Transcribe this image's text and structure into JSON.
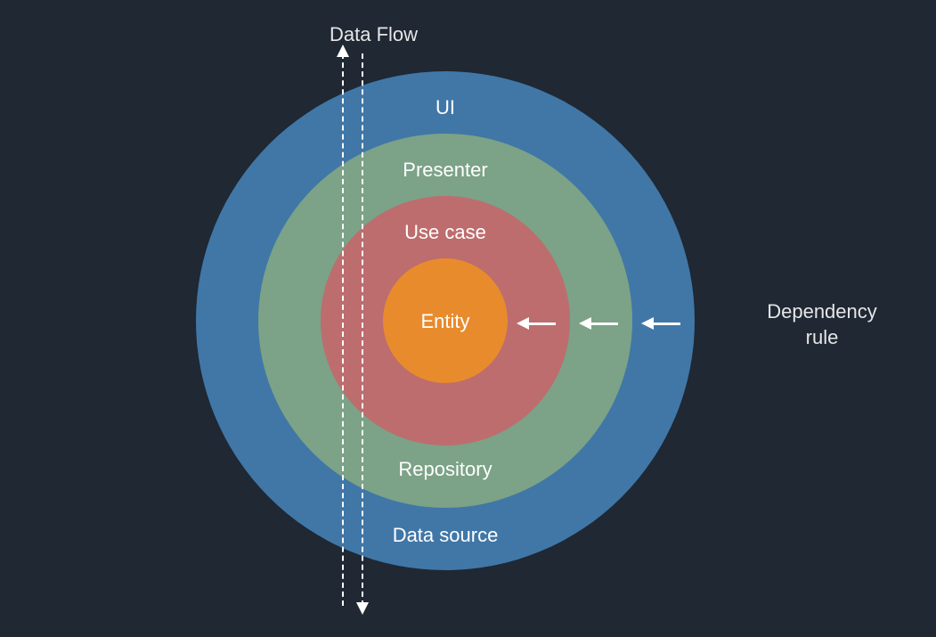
{
  "diagram": {
    "title_data_flow": "Data Flow",
    "title_dependency_rule": "Dependency\nrule",
    "rings": {
      "ui_top": "UI",
      "presenter": "Presenter",
      "usecase": "Use case",
      "entity": "Entity",
      "repository": "Repository",
      "datasource": "Data source"
    },
    "colors": {
      "background": "#1f2833",
      "ui": "#4077a7",
      "presenter_repository": "#7ca287",
      "usecase": "#bd6d6d",
      "entity": "#e88b2d",
      "text": "#ffffff"
    }
  }
}
